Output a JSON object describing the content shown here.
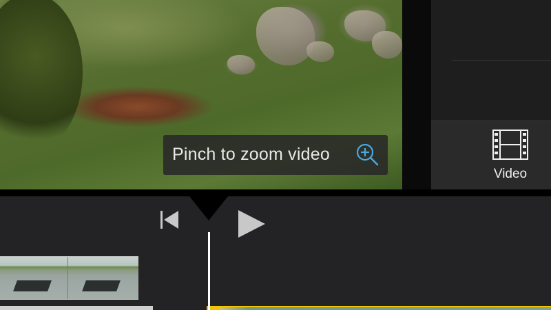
{
  "viewer": {
    "hint": {
      "text": "Pinch to zoom video",
      "icon": "zoom-in-icon",
      "icon_color": "#4aa8e0"
    }
  },
  "panel": {
    "video_button": {
      "label": "Video",
      "icon": "film-strip-icon"
    }
  },
  "controls": {
    "rewind_icon": "skip-to-start-icon",
    "play_icon": "play-icon"
  },
  "timeline": {
    "playhead_color": "#ffffff",
    "audio_color": "#f0c400"
  }
}
